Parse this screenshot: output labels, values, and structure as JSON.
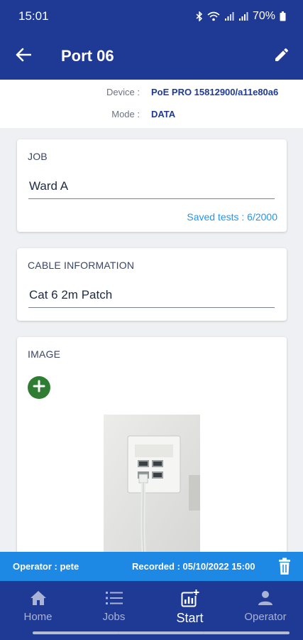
{
  "status_bar": {
    "time": "15:01",
    "battery": "70%"
  },
  "app_bar": {
    "title": "Port 06",
    "icons": {
      "back": "arrow-back-icon",
      "edit": "pencil-icon"
    }
  },
  "device_info": {
    "device_label": "Device :",
    "device_value": "PoE PRO 15812900/a11e80a6",
    "mode_label": "Mode :",
    "mode_value": "DATA"
  },
  "job": {
    "label": "JOB",
    "value": "Ward A",
    "saved_tests": "Saved tests : 6/2000"
  },
  "cable": {
    "label": "CABLE INFORMATION",
    "value": "Cat 6 2m Patch"
  },
  "image": {
    "label": "IMAGE",
    "add_icon": "add-circle-icon"
  },
  "operator_bar": {
    "operator": "Operator : pete",
    "recorded": "Recorded : 05/10/2022 15:00",
    "delete_icon": "trash-icon"
  },
  "bottom_nav": {
    "items": [
      {
        "label": "Home",
        "icon": "home-icon"
      },
      {
        "label": "Jobs",
        "icon": "list-icon"
      },
      {
        "label": "Start",
        "icon": "chart-add-icon",
        "active": true
      },
      {
        "label": "Operator",
        "icon": "person-icon"
      }
    ]
  },
  "colors": {
    "primary": "#1e3a94",
    "accent_blue": "#1e88e5",
    "link_blue": "#2196f3",
    "add_green": "#2e7d32",
    "background": "#eef0f3"
  }
}
